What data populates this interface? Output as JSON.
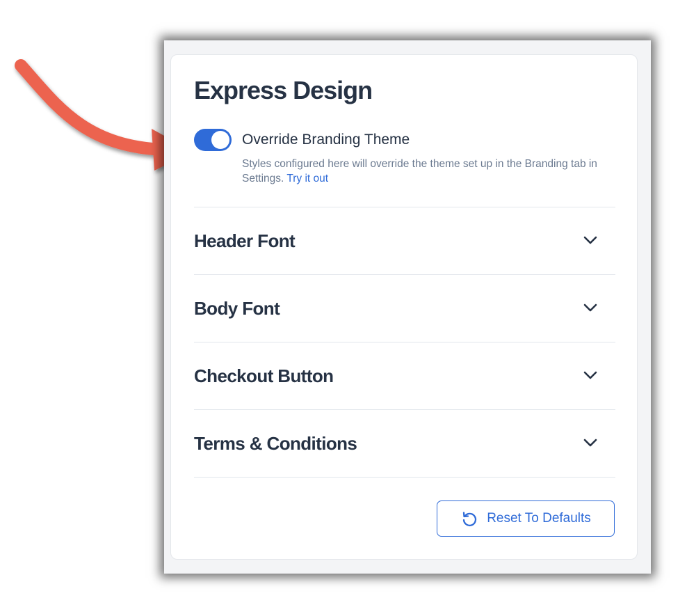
{
  "panel": {
    "title": "Express Design",
    "override": {
      "label": "Override Branding Theme",
      "enabled": true,
      "help_text": "Styles configured here will override the theme set up in the Branding tab in Settings.",
      "link_text": "Try it out"
    },
    "sections": [
      {
        "label": "Header Font",
        "icon": "chevron-down-icon"
      },
      {
        "label": "Body Font",
        "icon": "chevron-down-icon"
      },
      {
        "label": "Checkout Button",
        "icon": "chevron-down-icon"
      },
      {
        "label": "Terms & Conditions",
        "icon": "chevron-down-icon"
      }
    ],
    "reset_button": {
      "label": "Reset To Defaults",
      "icon": "undo-icon"
    }
  },
  "colors": {
    "accent": "#2f6bd8",
    "heading": "#263244",
    "muted": "#6b7a90",
    "annotation_arrow": "#ec6450"
  }
}
